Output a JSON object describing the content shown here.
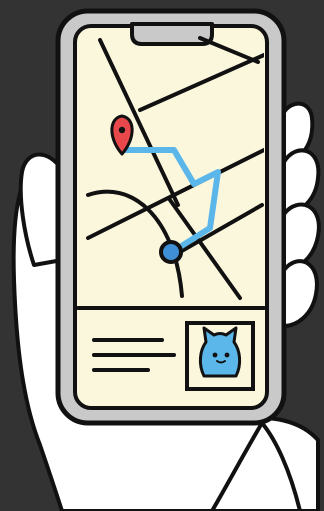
{
  "colors": {
    "background": "#333333",
    "outline": "#111111",
    "hand": "#ffffff",
    "phone_frame": "#c9c9c9",
    "screen": "#fbf7dc",
    "route": "#5bb6ea",
    "pin": "#e8474b",
    "location_dot": "#3f8fd6",
    "cat": "#5bb6ea"
  },
  "icons": [
    "hand-icon",
    "smartphone-icon",
    "map-pin-icon",
    "location-dot-icon",
    "cat-avatar-icon",
    "text-lines-icon"
  ]
}
